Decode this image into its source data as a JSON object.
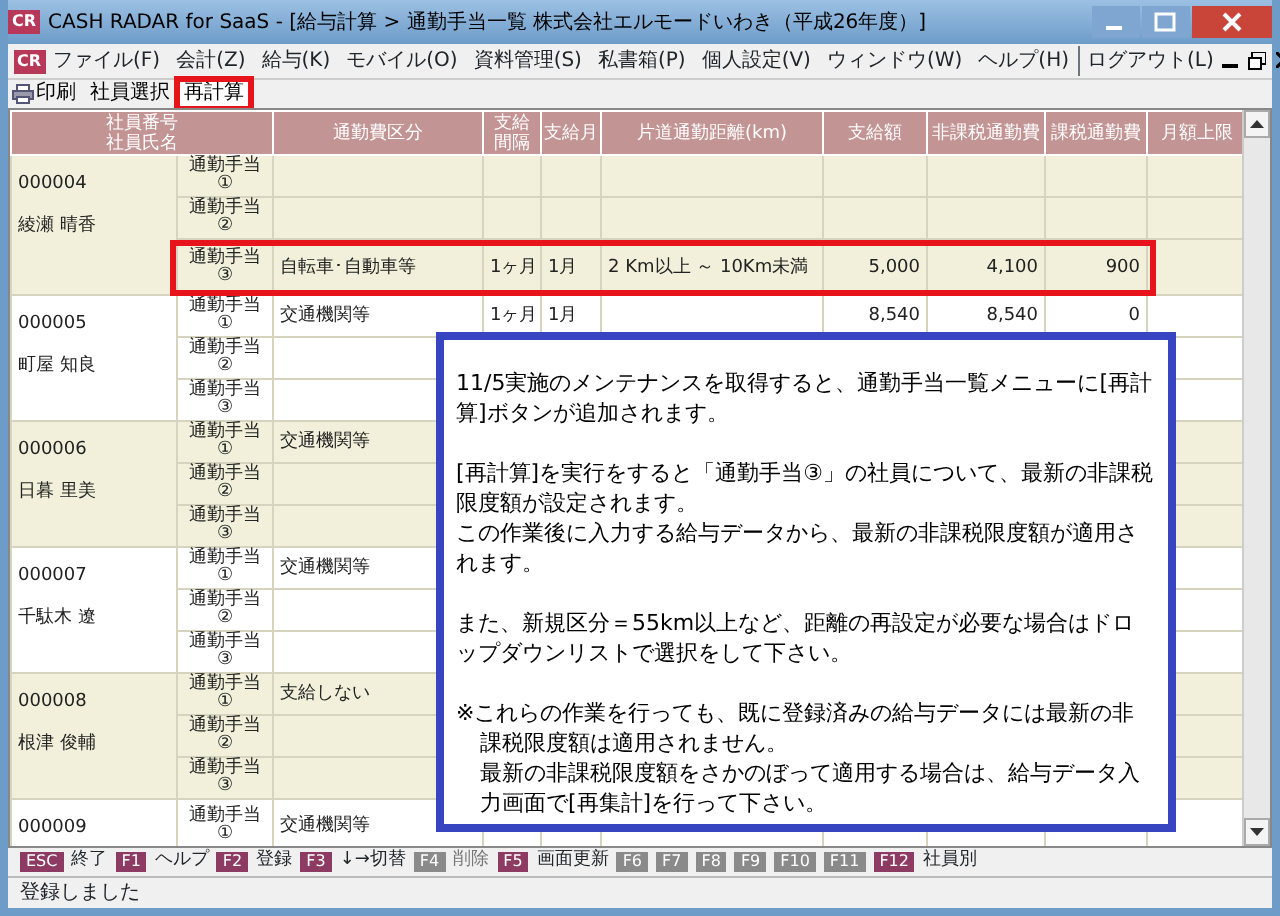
{
  "window": {
    "title": "CASH RADAR for SaaS - [給与計算 > 通勤手当一覧 株式会社エルモードいわき（平成26年度）]",
    "app_icon": "CR"
  },
  "menu": {
    "app_icon": "CR",
    "items": [
      "ファイル(F)",
      "会計(Z)",
      "給与(K)",
      "モバイル(O)",
      "資料管理(S)",
      "私書箱(P)",
      "個人設定(V)",
      "ウィンドウ(W)",
      "ヘルプ(H)"
    ],
    "logout": "ログアウト(L)"
  },
  "toolbar": [
    {
      "kind": "print",
      "label": "印刷",
      "highlighted": false
    },
    {
      "kind": "text",
      "label": "社員選択",
      "highlighted": false
    },
    {
      "kind": "text",
      "label": "再計算",
      "highlighted": true
    }
  ],
  "table": {
    "columns": [
      {
        "lines": [
          "社員番号",
          "社員氏名"
        ]
      },
      {
        "lines": [
          "通勤費区分"
        ]
      },
      {
        "lines": [
          "支給",
          "間隔"
        ]
      },
      {
        "lines": [
          "支給月"
        ]
      },
      {
        "lines": [
          "片道通勤距離(km)"
        ]
      },
      {
        "lines": [
          "支給額"
        ]
      },
      {
        "lines": [
          "非課税通勤費"
        ]
      },
      {
        "lines": [
          "課税通勤費"
        ]
      },
      {
        "lines": [
          "月額上限"
        ]
      }
    ],
    "groups": [
      {
        "id": "000004",
        "name": "綾瀬 晴香",
        "rows": [
          {
            "label": "通勤手当",
            "number": "①",
            "highlighted": false
          },
          {
            "label": "通勤手当",
            "number": "②",
            "highlighted": false
          },
          {
            "label": "通勤手当",
            "number": "③",
            "category": "自転車･自動車等",
            "interval": "1ヶ月",
            "month": "1月",
            "distance": "2 Km以上 ～ 10Km未満",
            "amount": "5,000",
            "nontaxable": "4,100",
            "taxable": "900",
            "highlighted": true
          }
        ]
      },
      {
        "id": "000005",
        "name": "町屋 知良",
        "rows": [
          {
            "label": "通勤手当",
            "number": "①",
            "category": "交通機関等",
            "interval": "1ヶ月",
            "month": "1月",
            "amount": "8,540",
            "nontaxable": "8,540",
            "taxable": "0",
            "highlighted": false
          },
          {
            "label": "通勤手当",
            "number": "②",
            "highlighted": false
          },
          {
            "label": "通勤手当",
            "number": "③",
            "highlighted": false
          }
        ]
      },
      {
        "id": "000006",
        "name": "日暮 里美",
        "rows": [
          {
            "label": "通勤手当",
            "number": "①",
            "category": "交通機関等",
            "highlighted": false
          },
          {
            "label": "通勤手当",
            "number": "②",
            "highlighted": false
          },
          {
            "label": "通勤手当",
            "number": "③",
            "highlighted": false
          }
        ]
      },
      {
        "id": "000007",
        "name": "千駄木 遼",
        "rows": [
          {
            "label": "通勤手当",
            "number": "①",
            "category": "交通機関等",
            "highlighted": false
          },
          {
            "label": "通勤手当",
            "number": "②",
            "highlighted": false
          },
          {
            "label": "通勤手当",
            "number": "③",
            "highlighted": false
          }
        ]
      },
      {
        "id": "000008",
        "name": "根津 俊輔",
        "rows": [
          {
            "label": "通勤手当",
            "number": "①",
            "category": "支給しない",
            "highlighted": false
          },
          {
            "label": "通勤手当",
            "number": "②",
            "highlighted": false
          },
          {
            "label": "通勤手当",
            "number": "③",
            "highlighted": false
          }
        ]
      },
      {
        "id": "000009",
        "rows": [
          {
            "label": "通勤手当",
            "number": "①",
            "category": "交通機関等",
            "highlighted": false
          }
        ]
      }
    ]
  },
  "function_keys": [
    {
      "key": "ESC",
      "label": "終了",
      "enabled": true
    },
    {
      "key": "F1",
      "label": "ヘルプ",
      "enabled": true
    },
    {
      "key": "F2",
      "label": "登録",
      "enabled": true
    },
    {
      "key": "F3",
      "label": "↓→切替",
      "enabled": true
    },
    {
      "key": "F4",
      "label": "削除",
      "enabled": false
    },
    {
      "key": "F5",
      "label": "画面更新",
      "enabled": true
    },
    {
      "key": "F6",
      "enabled": false
    },
    {
      "key": "F7",
      "enabled": false
    },
    {
      "key": "F8",
      "enabled": false
    },
    {
      "key": "F9",
      "enabled": false
    },
    {
      "key": "F10",
      "enabled": false
    },
    {
      "key": "F11",
      "enabled": false
    },
    {
      "key": "F12",
      "label": "社員別",
      "enabled": true
    }
  ],
  "note": {
    "blocks": [
      {
        "kind": "plain",
        "paragraphs": [
          "11/5実施のメンテナンスを取得すると、通勤手当一覧メニューに[再計算]ボタンが追加されます。"
        ]
      },
      {
        "kind": "plain",
        "paragraphs": [
          "[再計算]を実行をすると「通勤手当③」の社員について、最新の非課税限度額が設定されます。",
          "この作業後に入力する給与データから、最新の非課税限度額が適用されます。"
        ]
      },
      {
        "kind": "plain",
        "paragraphs": [
          "また、新規区分＝55km以上など、距離の再設定が必要な場合はドロップダウンリストで選択をして下さい。"
        ]
      },
      {
        "kind": "footnote",
        "paragraphs": [
          "※これらの作業を行っても、既に登録済みの給与データには最新の非課税限度額は適用されません。",
          "最新の非課税限度額をさかのぼって適用する場合は、給与データ入力画面で[再集計]を行って下さい。"
        ]
      }
    ]
  },
  "status_bar": "登録しました"
}
